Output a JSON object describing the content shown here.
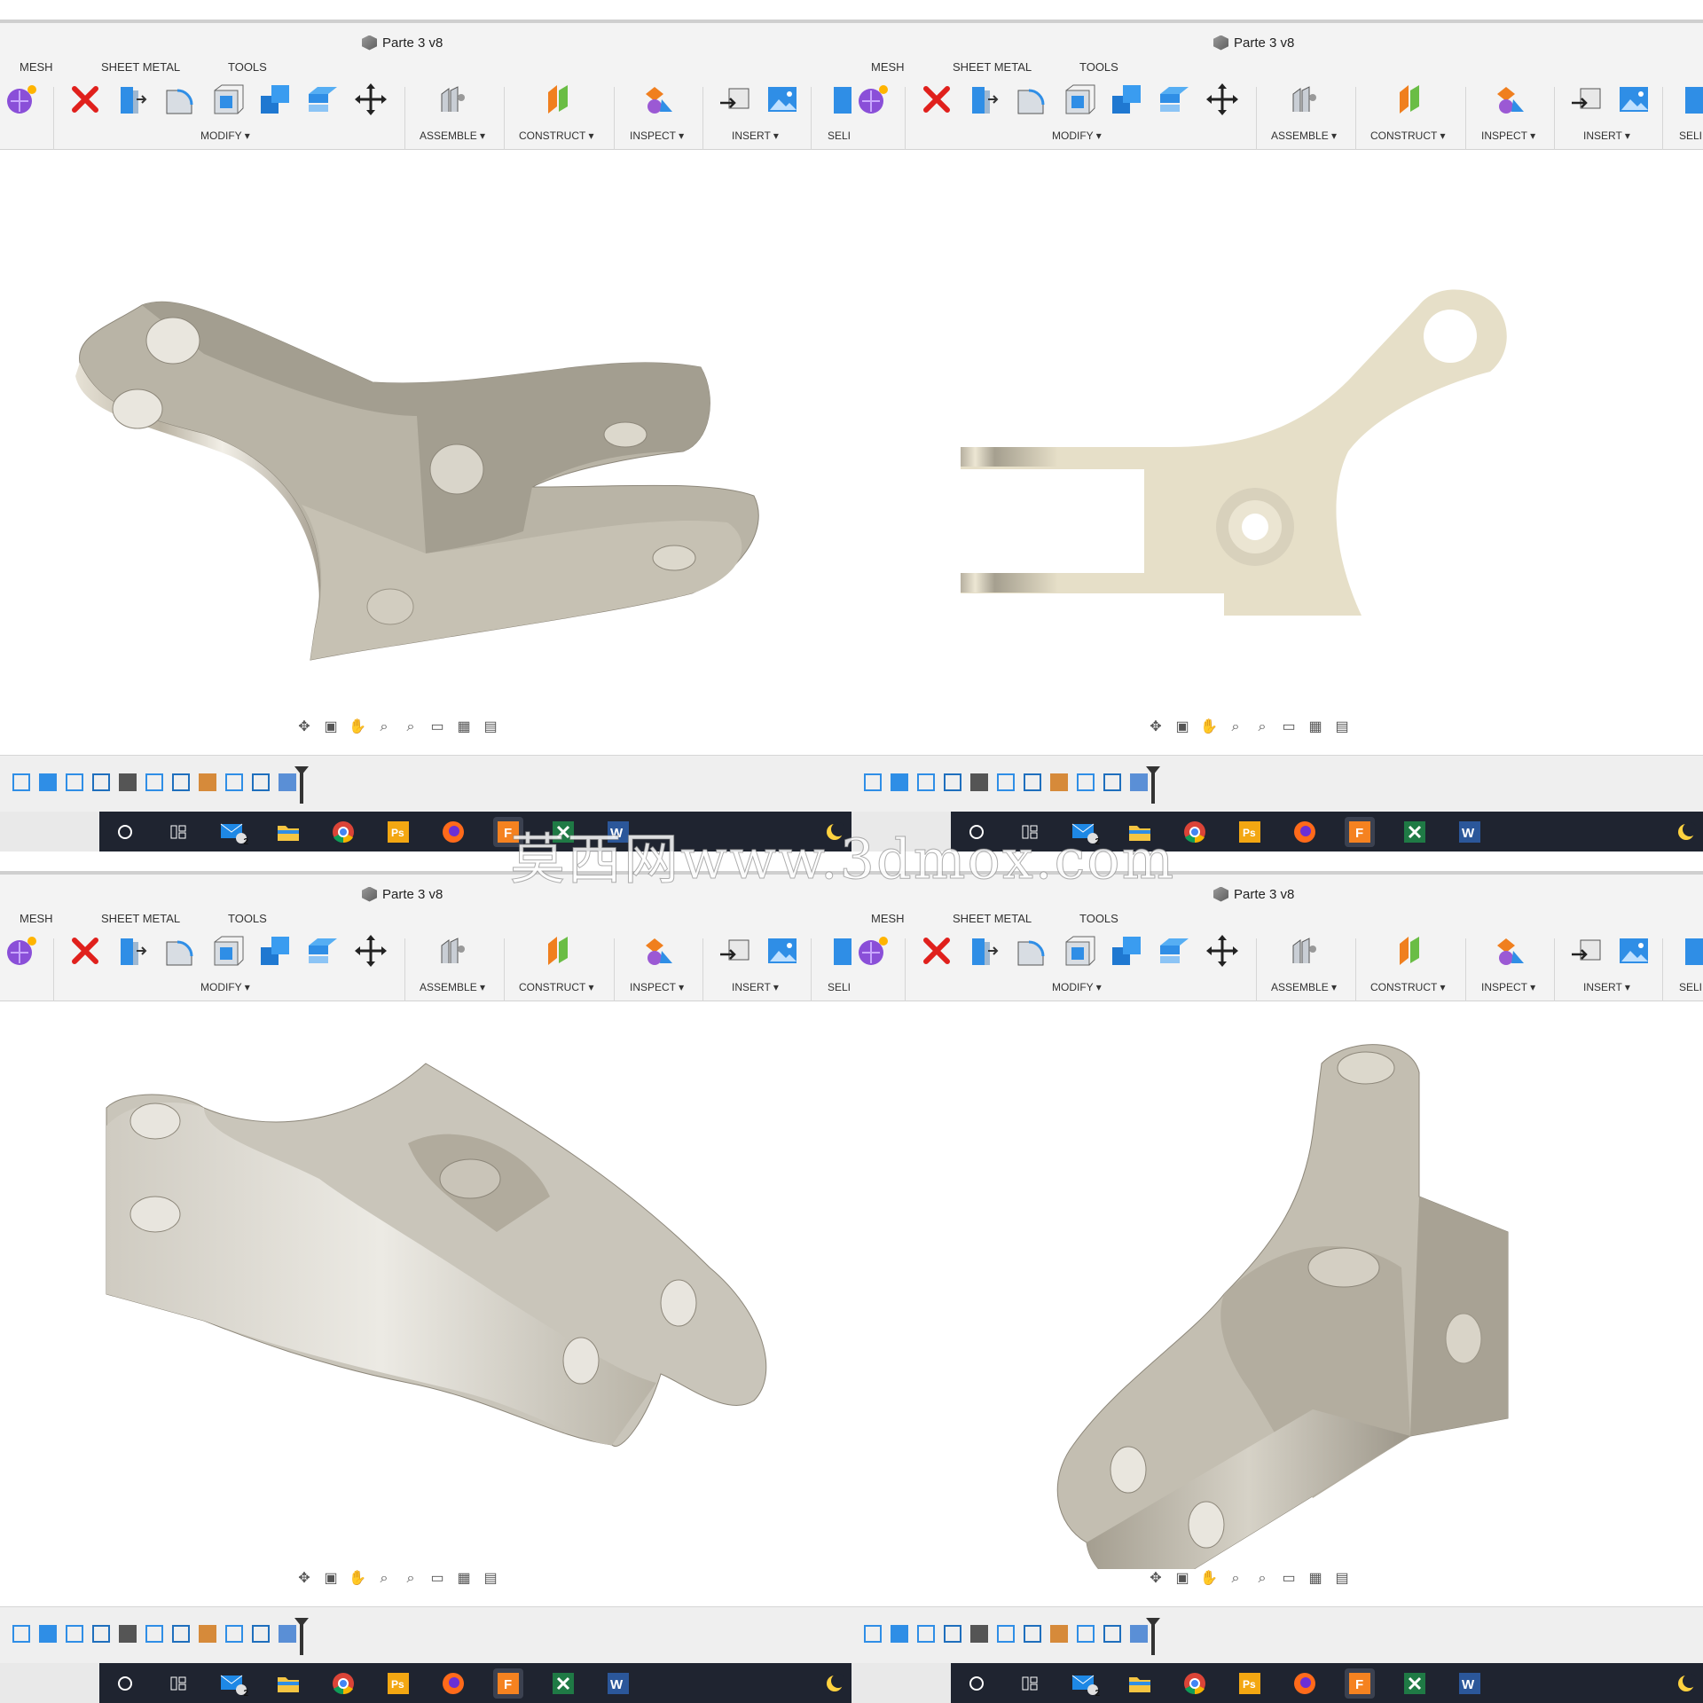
{
  "window": {
    "title": "Parte 3 v8"
  },
  "tabs": [
    "MESH",
    "SHEET METAL",
    "TOOLS"
  ],
  "groups": {
    "modify": "MODIFY ▾",
    "assemble": "ASSEMBLE ▾",
    "construct": "CONSTRUCT ▾",
    "inspect": "INSPECT ▾",
    "insert": "INSERT ▾",
    "select": "SELI"
  },
  "taskbar": {
    "mail_badge": "2"
  },
  "watermark": "莫西网www.3dmox.com",
  "colors": {
    "ribbon_bg": "#f3f3f3",
    "taskbar_bg": "#1f2430",
    "part_metal": "#c9c4b6",
    "part_beige": "#e6dfc8"
  }
}
